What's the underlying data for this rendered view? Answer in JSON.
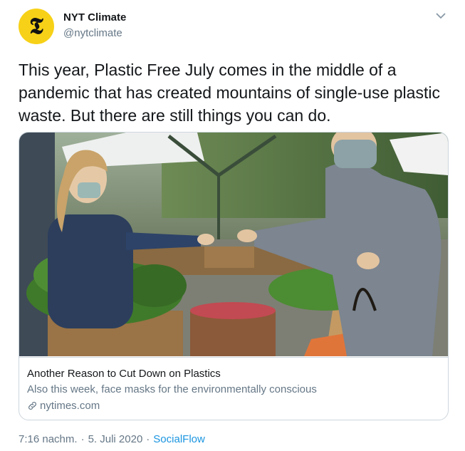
{
  "author": {
    "name": "NYT Climate",
    "handle": "@nytclimate",
    "avatar_glyph": "𝕿"
  },
  "tweet": {
    "text": "This year, Plastic Free July comes in the middle of a pandemic that has created mountains of single-use plastic waste. But there are still things you can do."
  },
  "card": {
    "title": "Another Reason to Cut Down on Plastics",
    "description": "Also this week, face masks for the environmentally conscious",
    "domain": "nytimes.com"
  },
  "meta": {
    "time": "7:16 nachm.",
    "date": "5. Juli 2020",
    "source": "SocialFlow",
    "separator": "·"
  },
  "icons": {
    "caret": "chevron-down-icon",
    "link": "link-icon"
  },
  "colors": {
    "avatar_bg": "#f7d117",
    "secondary_text": "#657786",
    "accent": "#1b95e0",
    "border": "#ccd6dd"
  }
}
